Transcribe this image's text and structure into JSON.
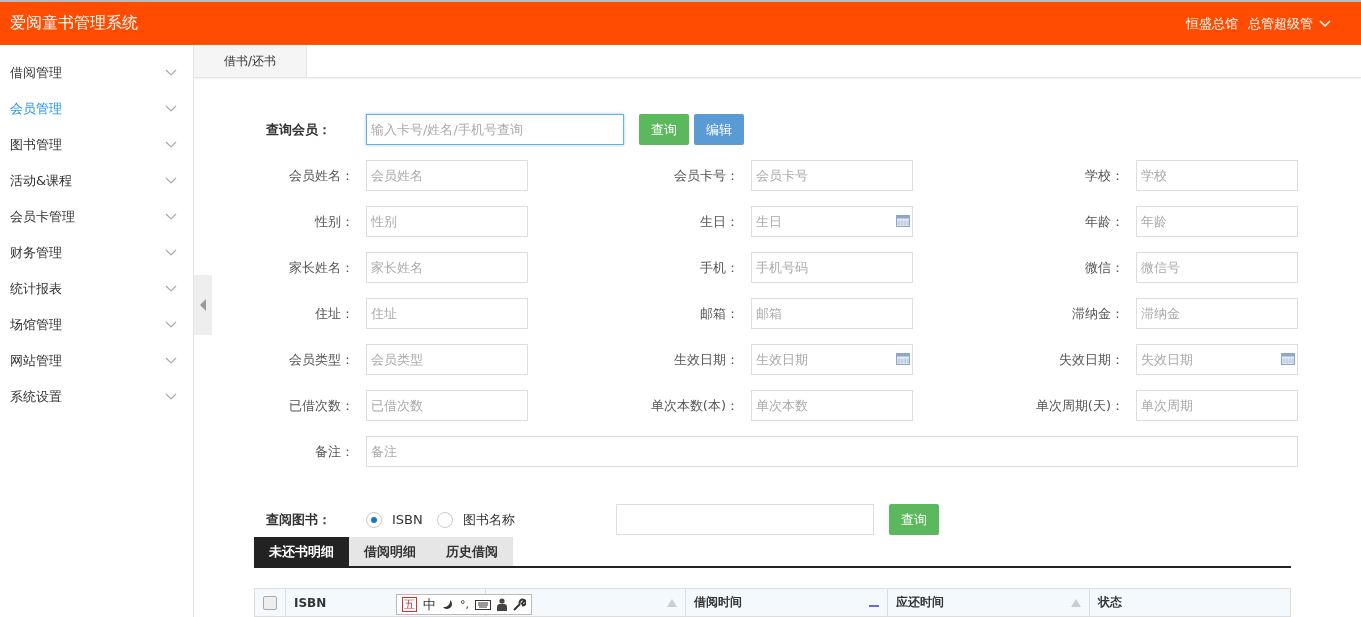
{
  "header": {
    "title": "爱阅童书管理系统",
    "branch": "恒盛总馆",
    "user": "总管超级管"
  },
  "sidebar": {
    "items": [
      {
        "label": "借阅管理",
        "selected": false
      },
      {
        "label": "会员管理",
        "selected": true
      },
      {
        "label": "图书管理",
        "selected": false
      },
      {
        "label": "活动&课程",
        "selected": false
      },
      {
        "label": "会员卡管理",
        "selected": false
      },
      {
        "label": "财务管理",
        "selected": false
      },
      {
        "label": "统计报表",
        "selected": false
      },
      {
        "label": "场馆管理",
        "selected": false
      },
      {
        "label": "网站管理",
        "selected": false
      },
      {
        "label": "系统设置",
        "selected": false
      }
    ]
  },
  "tabs": [
    {
      "label": "借书/还书",
      "selected": true
    }
  ],
  "member_search": {
    "label": "查询会员：",
    "placeholder": "输入卡号/姓名/手机号查询",
    "buttons": [
      {
        "label": "查询",
        "kind": "primary"
      },
      {
        "label": "编辑",
        "kind": "info"
      }
    ]
  },
  "fields": [
    {
      "label": "会员姓名：",
      "placeholder": "会员姓名",
      "kind": "text"
    },
    {
      "label": "会员卡号：",
      "placeholder": "会员卡号",
      "kind": "text"
    },
    {
      "label": "学校：",
      "placeholder": "学校",
      "kind": "text"
    },
    {
      "label": "性别：",
      "placeholder": "性别",
      "kind": "text"
    },
    {
      "label": "生日：",
      "placeholder": "生日",
      "kind": "date"
    },
    {
      "label": "年龄：",
      "placeholder": "年龄",
      "kind": "text"
    },
    {
      "label": "家长姓名：",
      "placeholder": "家长姓名",
      "kind": "text"
    },
    {
      "label": "手机：",
      "placeholder": "手机号码",
      "kind": "text"
    },
    {
      "label": "微信：",
      "placeholder": "微信号",
      "kind": "text"
    },
    {
      "label": "住址：",
      "placeholder": "住址",
      "kind": "text"
    },
    {
      "label": "邮箱：",
      "placeholder": "邮箱",
      "kind": "text"
    },
    {
      "label": "滞纳金：",
      "placeholder": "滞纳金",
      "kind": "text"
    },
    {
      "label": "会员类型：",
      "placeholder": "会员类型",
      "kind": "text"
    },
    {
      "label": "生效日期：",
      "placeholder": "生效日期",
      "kind": "date"
    },
    {
      "label": "失效日期：",
      "placeholder": "失效日期",
      "kind": "date"
    },
    {
      "label": "已借次数：",
      "placeholder": "已借次数",
      "kind": "text"
    },
    {
      "label": "单次本数(本)：",
      "placeholder": "单次本数",
      "kind": "text"
    },
    {
      "label": "单次周期(天)：",
      "placeholder": "单次周期",
      "kind": "text"
    }
  ],
  "remark": {
    "label": "备注：",
    "placeholder": "备注"
  },
  "book_search": {
    "label": "查阅图书：",
    "options": [
      {
        "label": "ISBN",
        "selected": true
      },
      {
        "label": "图书名称",
        "selected": false
      }
    ],
    "button": "查询"
  },
  "detail_tabs": [
    {
      "label": "未还书明细",
      "selected": true
    },
    {
      "label": "借阅明细",
      "selected": false
    },
    {
      "label": "历史借阅",
      "selected": false
    }
  ],
  "table": {
    "columns": [
      {
        "kind": "checkbox",
        "checked": false
      },
      {
        "kind": "text",
        "label": "ISBN"
      },
      {
        "kind": "text",
        "sortable": true,
        "sorted": false
      },
      {
        "kind": "text",
        "label": "借阅时间",
        "sortable": true,
        "sorted": true
      },
      {
        "kind": "text",
        "label": "应还时间",
        "sortable": true,
        "sorted": false
      },
      {
        "kind": "text",
        "label": "状态"
      }
    ]
  },
  "ime_toolbar": {
    "mode_label": "五",
    "lang_label": "中",
    "punct_label": "°,"
  }
}
